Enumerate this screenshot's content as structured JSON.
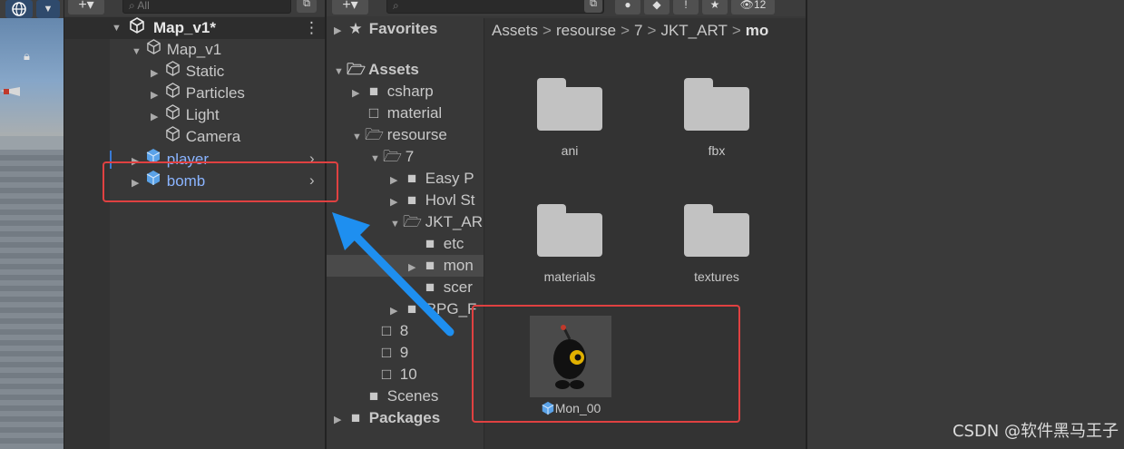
{
  "hierarchy": {
    "search_placeholder": "All",
    "scene_name": "Map_v1*",
    "items": [
      {
        "label": "Map_v1"
      },
      {
        "label": "Static"
      },
      {
        "label": "Particles"
      },
      {
        "label": "Light"
      },
      {
        "label": "Camera"
      },
      {
        "label": "player"
      },
      {
        "label": "bomb"
      }
    ]
  },
  "project": {
    "eye_count": "12",
    "favorites_label": "Favorites",
    "assets_label": "Assets",
    "packages_label": "Packages",
    "tree": [
      {
        "label": "csharp"
      },
      {
        "label": "material"
      },
      {
        "label": "resourse"
      },
      {
        "label": "7"
      },
      {
        "label": "Easy P"
      },
      {
        "label": "Hovl St"
      },
      {
        "label": "JKT_AR"
      },
      {
        "label": "etc"
      },
      {
        "label": "mon"
      },
      {
        "label": "scer"
      },
      {
        "label": "RPG_F"
      },
      {
        "label": "8"
      },
      {
        "label": "9"
      },
      {
        "label": "10"
      },
      {
        "label": "Scenes"
      }
    ],
    "breadcrumb": [
      "Assets",
      "resourse",
      "7",
      "JKT_ART",
      "mo"
    ],
    "grid_items": [
      {
        "label": "ani"
      },
      {
        "label": "fbx"
      },
      {
        "label": "materials"
      },
      {
        "label": "textures"
      },
      {
        "label": "Mon_00"
      }
    ]
  },
  "watermark": "CSDN @软件黑马王子",
  "colors": {
    "annotation_red": "#e04141",
    "arrow_blue": "#1e8ff0",
    "prefab_blue": "#8ab4ff"
  }
}
